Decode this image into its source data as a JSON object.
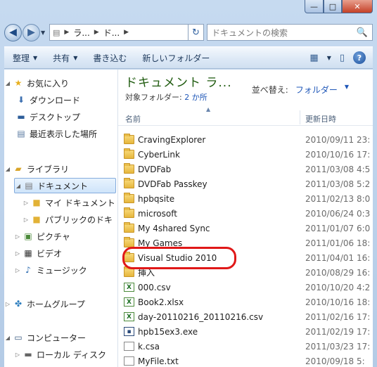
{
  "window": {
    "min_label": "—",
    "max_label": "□",
    "close_label": "✕"
  },
  "address": {
    "back": "◀",
    "forward": "▶",
    "segments": [
      "ラ...",
      "ド..."
    ],
    "refresh": "↻",
    "search_placeholder": "ドキュメントの検索",
    "search_icon": "🔍"
  },
  "toolbar": {
    "organize": "整理",
    "share": "共有",
    "burn": "書き込む",
    "new_folder": "新しいフォルダー",
    "help": "?"
  },
  "nav": {
    "favorites": "お気に入り",
    "downloads": "ダウンロード",
    "desktop": "デスクトップ",
    "recent": "最近表示した場所",
    "libraries": "ライブラリ",
    "documents": "ドキュメント",
    "my_documents": "マイ ドキュメント",
    "public_documents": "パブリックのドキ",
    "pictures": "ピクチャ",
    "videos": "ビデオ",
    "music": "ミュージック",
    "homegroup": "ホームグループ",
    "computer": "コンピューター",
    "local_disk": "ローカル ディスク"
  },
  "content": {
    "title": "ドキュメント ラ...",
    "target_label": "対象フォルダー:",
    "target_count": "2 か所",
    "arrange_label": "並べ替え:",
    "arrange_value": "フォルダー",
    "col_name": "名前",
    "col_date": "更新日時",
    "files": [
      {
        "name": "CravingExplorer",
        "date": "2010/09/11 23:",
        "type": "folder"
      },
      {
        "name": "CyberLink",
        "date": "2010/10/16 17:",
        "type": "folder"
      },
      {
        "name": "DVDFab",
        "date": "2011/03/08 4:5",
        "type": "folder"
      },
      {
        "name": "DVDFab Passkey",
        "date": "2011/03/08 5:2",
        "type": "folder"
      },
      {
        "name": "hpbqsite",
        "date": "2011/02/13 8:0",
        "type": "folder"
      },
      {
        "name": "microsoft",
        "date": "2010/06/24 0:3",
        "type": "folder"
      },
      {
        "name": "My 4shared Sync",
        "date": "2011/01/07 6:0",
        "type": "folder"
      },
      {
        "name": "My Games",
        "date": "2011/01/06 18:",
        "type": "folder"
      },
      {
        "name": "Visual Studio 2010",
        "date": "2011/04/01 16:",
        "type": "folder"
      },
      {
        "name": "挿入",
        "date": "2010/08/29 16:",
        "type": "folder"
      },
      {
        "name": "000.csv",
        "date": "2010/10/20 4:2",
        "type": "xls"
      },
      {
        "name": "Book2.xlsx",
        "date": "2010/10/16 18:",
        "type": "xls"
      },
      {
        "name": "day-20110216_20110216.csv",
        "date": "2011/02/16 17:",
        "type": "xls"
      },
      {
        "name": "hpb15ex3.exe",
        "date": "2011/02/19 17:",
        "type": "exe"
      },
      {
        "name": "k.csa",
        "date": "2011/03/23 17:",
        "type": "doc"
      },
      {
        "name": "MyFile.txt",
        "date": "2010/09/18 5:",
        "type": "doc"
      }
    ]
  }
}
